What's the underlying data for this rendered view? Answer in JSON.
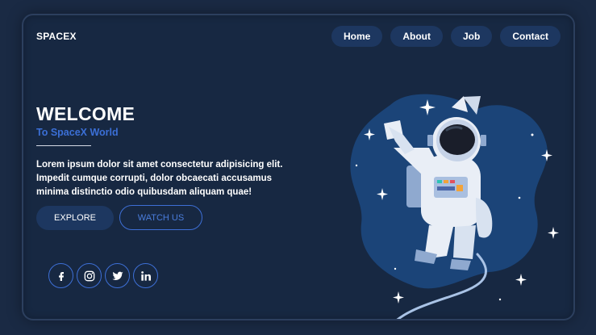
{
  "brand": {
    "name": "SPACEX"
  },
  "nav": {
    "items": [
      {
        "label": "Home"
      },
      {
        "label": "About"
      },
      {
        "label": "Job"
      },
      {
        "label": "Contact"
      }
    ]
  },
  "hero": {
    "title": "WELCOME",
    "subtitle": "To SpaceX World",
    "description": "Lorem ipsum dolor sit amet consectetur adipisicing elit. Impedit cumque corrupti, dolor obcaecati accusamus minima distinctio odio quibusdam aliquam quae!",
    "explore_label": "EXPLORE",
    "watch_label": "WATCH US"
  },
  "social": {
    "icons": [
      "facebook-icon",
      "instagram-icon",
      "twitter-icon",
      "linkedin-icon"
    ]
  },
  "colors": {
    "background": "#172842",
    "accent": "#3b6fd6",
    "pill": "#1d3760",
    "text": "#ffffff"
  }
}
